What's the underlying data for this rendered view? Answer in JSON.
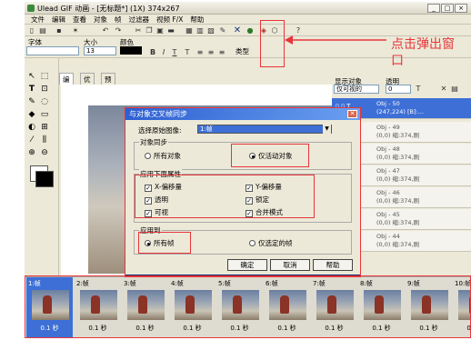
{
  "window": {
    "title": "Ulead GIF 动画 - [无标题*] (1X) 374x267"
  },
  "menu": [
    "文件",
    "编辑",
    "查看",
    "对象",
    "帧",
    "过滤器",
    "视频 F/X",
    "帮助"
  ],
  "properties": {
    "font_label": "字体",
    "size_label": "大小",
    "size_value": "13",
    "color_label": "颜色",
    "style_label": "类型"
  },
  "tabs": [
    "编辑",
    "优化",
    "预览"
  ],
  "panel": {
    "show_objects_label": "显示对象",
    "show_objects_value": "仅可视的",
    "opacity_label": "透明",
    "opacity_value": "0"
  },
  "objects": [
    {
      "name": "Obj - 50",
      "info": "(247,224) [B]:..."
    },
    {
      "name": "Obj - 49",
      "info": "(0,0) 缩:374,刷"
    },
    {
      "name": "Obj - 48",
      "info": "(0,0) 缩:374,刷"
    },
    {
      "name": "Obj - 47",
      "info": "(0,0) 缩:374,刷"
    },
    {
      "name": "Obj - 46",
      "info": "(0,0) 缩:374,刷"
    },
    {
      "name": "Obj - 45",
      "info": "(0,0) 缩:374,刷"
    },
    {
      "name": "Obj - 44",
      "info": "(0,0) 缩:374,刷"
    }
  ],
  "dialog": {
    "title": "与对象交叉帧同步",
    "source_label": "选择原始图像:",
    "source_value": "1:帧",
    "sync_group": "对象同步",
    "all_objects": "所有对象",
    "active_only": "仅活动对象",
    "attr_group": "应用下面属性",
    "attrs": [
      "X-偏移量",
      "Y-偏移量",
      "透明",
      "锁定",
      "可视",
      "合并模式"
    ],
    "apply_group": "应用到",
    "all_frames": "所有帧",
    "selected_frames": "仅选定的帧",
    "ok": "确定",
    "cancel": "取消",
    "help": "帮助"
  },
  "frames": [
    {
      "label": "1:帧",
      "delay": "0.1 秒"
    },
    {
      "label": "2:帧",
      "delay": "0.1 秒"
    },
    {
      "label": "3:帧",
      "delay": "0.1 秒"
    },
    {
      "label": "4:帧",
      "delay": "0.1 秒"
    },
    {
      "label": "5:帧",
      "delay": "0.1 秒"
    },
    {
      "label": "6:帧",
      "delay": "0.1 秒"
    },
    {
      "label": "7:帧",
      "delay": "0.1 秒"
    },
    {
      "label": "8:帧",
      "delay": "0.1 秒"
    },
    {
      "label": "9:帧",
      "delay": "0.1 秒"
    },
    {
      "label": "10:帧",
      "delay": "0.1 秒"
    }
  ],
  "annotation": {
    "text_line1": "点击弹出窗",
    "text_line2": "口",
    "color": "#e8353a"
  }
}
